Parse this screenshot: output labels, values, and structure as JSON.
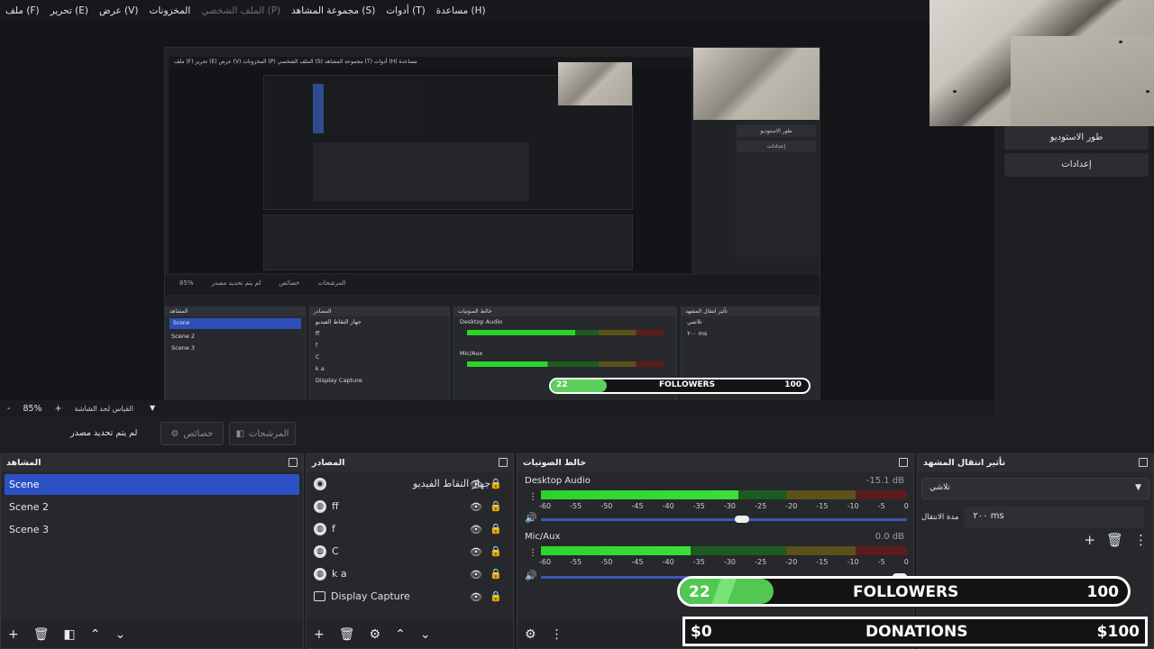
{
  "menu": [
    "ملف (F)",
    "تحرير (E)",
    "عرض (V)",
    "المخزونات",
    "الملف الشخصي (P)",
    "مجموعة المشاهد (S)",
    "أدوات (T)",
    "مساعدة (H)"
  ],
  "zoom": {
    "minus": "-",
    "value": "85%",
    "plus": "+",
    "fit": "القياس لحد الشاشة"
  },
  "controls": {
    "no_source": "لم يتم تحديد مصدر",
    "properties": "خصائص",
    "filters": "المرشحات"
  },
  "right_buttons": {
    "studio": "طور الاستوديو",
    "settings": "إعدادات"
  },
  "scenes": {
    "title": "المشاهد",
    "items": [
      "Scene",
      "Scene 2",
      "Scene 3"
    ]
  },
  "sources": {
    "title": "المصادر",
    "items": [
      "جهاز التقاط الفيديو",
      "ff",
      "f",
      "C",
      "k a",
      "Display Capture"
    ]
  },
  "mixer": {
    "title": "خالط الصوتيات",
    "channels": [
      {
        "name": "Desktop Audio",
        "db": "-15.1 dB",
        "level": 0.54,
        "volume": 0.55
      },
      {
        "name": "Mic/Aux",
        "db": "0.0 dB",
        "level": 0.41,
        "volume": 1.0
      }
    ],
    "ticks": [
      "-60",
      "-55",
      "-50",
      "-45",
      "-40",
      "-35",
      "-30",
      "-25",
      "-20",
      "-15",
      "-10",
      "-5",
      "0"
    ]
  },
  "transitions": {
    "title": "تأثير انتقال المشهد",
    "selected": "تلاشي",
    "duration_label": "مدة الانتقال",
    "duration": "٢٠٠ ms"
  },
  "overlay": {
    "followers_count": "22",
    "followers_label": "FOLLOWERS",
    "followers_goal": "100",
    "followers_fraction": 0.22,
    "donations_amount": "$0",
    "donations_label": "DONATIONS",
    "donations_goal": "$100"
  }
}
